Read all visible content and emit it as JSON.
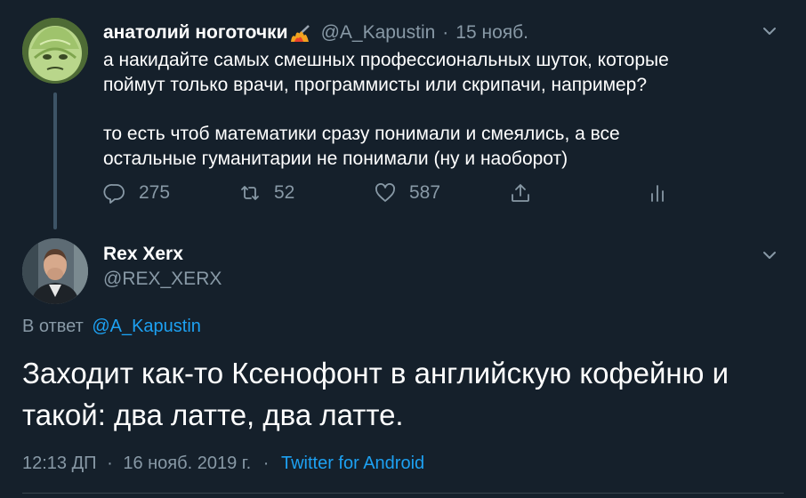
{
  "original_tweet": {
    "display_name": "анатолий ноготочки",
    "handle": "@A_Kapustin",
    "separator": "·",
    "date": "15 нояб.",
    "text_line1": "а накидайте самых смешных профессиональных шуток, которые",
    "text_line2": "поймут только врачи, программисты или скрипачи, например?",
    "text_line3": "то есть чтоб математики сразу понимали и смеялись, а все",
    "text_line4": "остальные гуманитарии не понимали (ну и наоборот)",
    "actions": {
      "reply_count": "275",
      "retweet_count": "52",
      "like_count": "587"
    },
    "icons": [
      "avatar-cabbage",
      "flame-emoji",
      "chevron-down-icon",
      "reply-icon",
      "retweet-icon",
      "like-icon",
      "share-icon",
      "analytics-icon"
    ]
  },
  "reply_tweet": {
    "display_name": "Rex Xerx",
    "handle": "@REX_XERX",
    "reply_prefix": "В ответ",
    "reply_to": "@A_Kapustin",
    "text_line1": "Заходит как-то Ксенофонт в английскую кофейню и",
    "text_line2": "такой: два латте, два латте.",
    "time": "12:13 ДП",
    "sep": "·",
    "date": "16 нояб. 2019 г.",
    "sep2": "·",
    "source": "Twitter for Android"
  },
  "colors": {
    "background": "#15202b",
    "muted": "#8899a6",
    "link": "#1da1f2",
    "thread_line": "#3d5466"
  }
}
